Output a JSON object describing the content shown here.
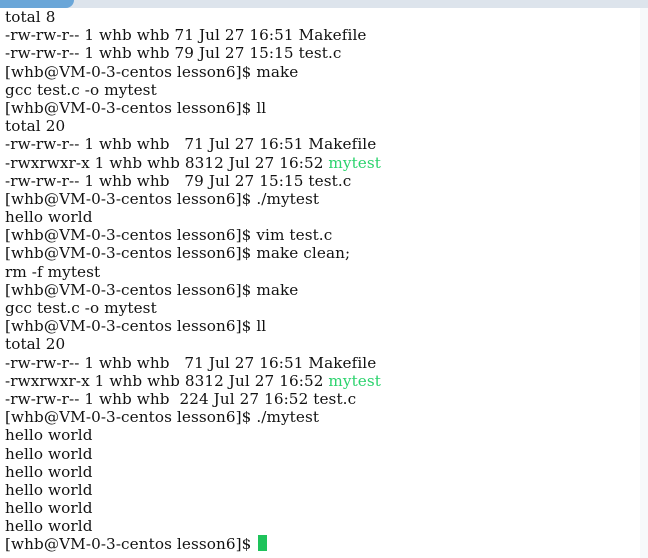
{
  "terminal": {
    "lines": [
      {
        "text": "total 8"
      },
      {
        "text": "-rw-rw-r-- 1 whb whb 71 Jul 27 16:51 Makefile"
      },
      {
        "text": "-rw-rw-r-- 1 whb whb 79 Jul 27 15:15 test.c"
      },
      {
        "text": "[whb@VM-0-3-centos lesson6]$ make"
      },
      {
        "text": "gcc test.c -o mytest"
      },
      {
        "text": "[whb@VM-0-3-centos lesson6]$ ll"
      },
      {
        "text": "total 20"
      },
      {
        "text": "-rw-rw-r-- 1 whb whb   71 Jul 27 16:51 Makefile"
      },
      {
        "prefix": "-rwxrwxr-x 1 whb whb 8312 Jul 27 16:52 ",
        "green": "mytest"
      },
      {
        "text": "-rw-rw-r-- 1 whb whb   79 Jul 27 15:15 test.c"
      },
      {
        "text": "[whb@VM-0-3-centos lesson6]$ ./mytest"
      },
      {
        "text": "hello world"
      },
      {
        "text": "[whb@VM-0-3-centos lesson6]$ vim test.c"
      },
      {
        "text": "[whb@VM-0-3-centos lesson6]$ make clean;"
      },
      {
        "text": "rm -f mytest"
      },
      {
        "text": "[whb@VM-0-3-centos lesson6]$ make"
      },
      {
        "text": "gcc test.c -o mytest"
      },
      {
        "text": "[whb@VM-0-3-centos lesson6]$ ll"
      },
      {
        "text": "total 20"
      },
      {
        "text": "-rw-rw-r-- 1 whb whb   71 Jul 27 16:51 Makefile"
      },
      {
        "prefix": "-rwxrwxr-x 1 whb whb 8312 Jul 27 16:52 ",
        "green": "mytest"
      },
      {
        "text": "-rw-rw-r-- 1 whb whb  224 Jul 27 16:52 test.c"
      },
      {
        "text": "[whb@VM-0-3-centos lesson6]$ ./mytest"
      },
      {
        "text": "hello world"
      },
      {
        "text": "hello world"
      },
      {
        "text": "hello world"
      },
      {
        "text": "hello world"
      },
      {
        "text": "hello world"
      },
      {
        "text": "hello world"
      }
    ],
    "prompt": "[whb@VM-0-3-centos lesson6]$ ",
    "colors": {
      "background": "#ffffff",
      "text": "#111111",
      "executable": "#2bd36d",
      "cursor": "#1ec35b"
    }
  }
}
